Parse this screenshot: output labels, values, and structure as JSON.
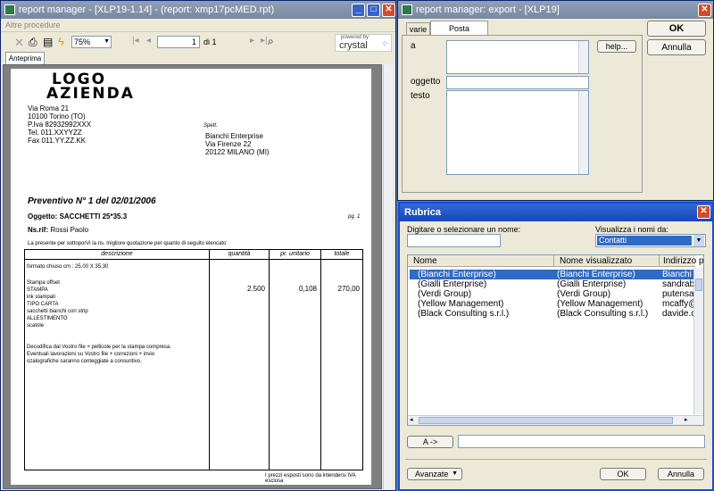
{
  "report_window": {
    "title": "report manager - [XLP19-1.14] - (report: xmp17pcMED.rpt)",
    "menu": "Altre procedure",
    "zoom": "75%",
    "page_current": "1",
    "page_of": "di 1",
    "powered_by": "powered by",
    "crystal": "crystal",
    "tab_label": "Anteprima"
  },
  "document": {
    "logo_line1": "LOGO",
    "logo_line2": "AZIENDA",
    "sender": [
      "Via Roma 21",
      "10100 Torino (TO)",
      "P.Iva 82932992XXX",
      "Tel. 011.XXYYZZ",
      "Fax 011.YY.ZZ.KK"
    ],
    "spett": "Spett.",
    "recipient": [
      "Bianchi Enterprise",
      "Via Firenze 22",
      "20122 MILANO (MI)"
    ],
    "quote_title": "Preventivo N° 1 del 02/01/2006",
    "subject_label": "Oggetto:",
    "subject_value": "SACCHETTI 25*35.3",
    "page_label": "pg. 1",
    "ref_label": "Ns.rif:",
    "ref_value": "Rossi Paolo",
    "intro": "La presente per sottoporVi la ns. migliore quotazione per quanto di seguito elencato",
    "table_headers": {
      "descr": "descrizione",
      "qty": "quantità",
      "price": "pr. unitario",
      "total": "totale"
    },
    "format_line": "formato chiuso cm : 25,00 X 35,30",
    "item_lines": [
      "Stampa offset",
      "STAMPA",
      "ink stampati",
      "TIPO CARTA",
      "sacchetti bianchi con strip",
      "ALLESTIMENTO",
      "scatole"
    ],
    "qty": "2.500",
    "price": "0,108",
    "total": "270,00",
    "notes": [
      "Decodifica dal Vostro file + pellicole per la stampa compresa.",
      "Eventuali lavorazioni su Vostro file + correzioni + invio",
      "ozalografiche saranno conteggiate a consuntivo."
    ],
    "footer": "I prezzi esposti sono da intendersi IVA esclusa"
  },
  "export_window": {
    "title": "report manager: export - [XLP19]",
    "tab_varie": "varie",
    "tab_posta": "Posta elettronica",
    "label_a": "a",
    "help_button": "help...",
    "label_oggetto": "oggetto",
    "label_testo": "testo",
    "ok_button": "OK",
    "cancel_button": "Annulla"
  },
  "rubrica": {
    "title": "Rubrica",
    "type_label": "Digitare o selezionare un nome:",
    "show_label": "Visualizza i nomi da:",
    "source_value": "Contatti",
    "columns": [
      "Nome",
      "Nome visualizzato",
      "Indirizzo posta"
    ],
    "rows": [
      {
        "name": "(Bianchi Enterprise)",
        "display": "(Bianchi Enterprise)",
        "email": "Bianchi E"
      },
      {
        "name": "(Gialli Enterprise)",
        "display": "(Gialli Enterprise)",
        "email": "sandrabosi"
      },
      {
        "name": "(Verdi Group)",
        "display": "(Verdi Group)",
        "email": "putensa@t"
      },
      {
        "name": "(Yellow Management)",
        "display": "(Yellow Management)",
        "email": "mcaffy@al"
      },
      {
        "name": "(Black Consulting s.r.l.)",
        "display": "(Black Consulting s.r.l.)",
        "email": "davide.caiu"
      }
    ],
    "to_button": "A ->",
    "advanced_button": "Avanzate",
    "ok_button": "OK",
    "cancel_button": "Annulla"
  }
}
